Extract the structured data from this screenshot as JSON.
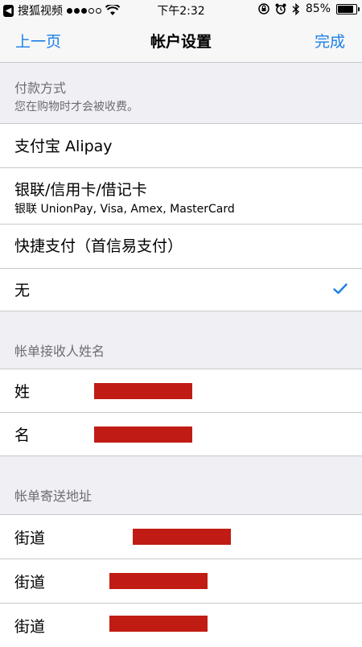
{
  "status_bar": {
    "back_app": "搜狐视频",
    "time": "下午2:32",
    "battery": "85%",
    "battery_level": 0.85
  },
  "nav": {
    "back": "上一页",
    "title": "帐户设置",
    "done": "完成"
  },
  "payment": {
    "header": "付款方式",
    "note": "您在购物时才会被收费。",
    "options": [
      {
        "label": "支付宝 Alipay",
        "sub": ""
      },
      {
        "label": "银联/信用卡/借记卡",
        "sub": "银联 UnionPay, Visa, Amex, MasterCard"
      },
      {
        "label": "快捷支付（首信易支付）",
        "sub": ""
      },
      {
        "label": "无",
        "sub": "",
        "selected": true
      }
    ]
  },
  "recipient": {
    "header": "帐单接收人姓名",
    "fields": [
      {
        "label": "姓"
      },
      {
        "label": "名"
      }
    ]
  },
  "address": {
    "header": "帐单寄送地址",
    "fields": [
      {
        "label": "街道"
      },
      {
        "label": "街道"
      },
      {
        "label": "街道"
      }
    ]
  },
  "colors": {
    "accent": "#1a7fe6",
    "background": "#efeff4",
    "redaction": "#c01c14"
  }
}
